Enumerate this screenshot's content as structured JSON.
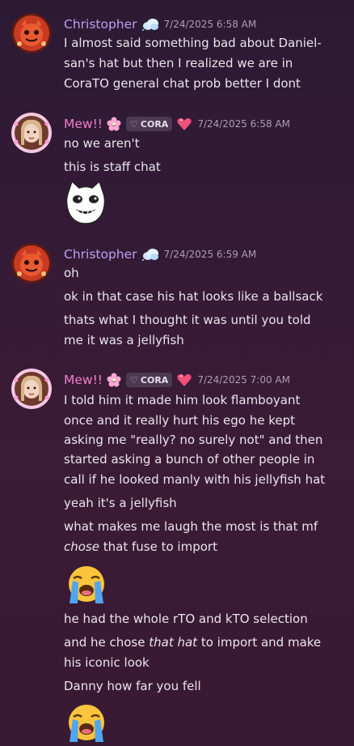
{
  "messages": [
    {
      "author": "Christopher",
      "timestamp": "7/24/2025 6:58 AM",
      "lines": [
        "I almost said something bad about Daniel-",
        "san's hat but then I realized we are in",
        "CoraTO general chat prob better I dont"
      ]
    },
    {
      "author": "Mew!!",
      "tag": "CORA",
      "timestamp": "7/24/2025 6:58 AM",
      "lines": [
        "no we aren't",
        "this is staff chat"
      ],
      "sticker": "cat-face-sticker"
    },
    {
      "author": "Christopher",
      "timestamp": "7/24/2025 6:59 AM",
      "lines": [
        "oh",
        "ok in that case his hat looks like a ballsack",
        "thats what I thought it was until you told",
        "me it was a jellyfish"
      ]
    },
    {
      "author": "Mew!!",
      "tag": "CORA",
      "timestamp": "7/24/2025 7:00 AM",
      "lines": [
        "I told him it made him look flamboyant",
        "once and it really hurt his ego he kept",
        "asking me \"really? no surely not\" and then",
        "started asking a bunch of other people in",
        "call if he looked manly with his jellyfish hat",
        "yeah it's a jellyfish",
        "what makes me laugh the most is that mf",
        "that fuse to import",
        "he had the whole rTO and kTO selection",
        "and he chose",
        "to import and make",
        "his iconic look",
        "Danny how far you fell"
      ],
      "italic": [
        "chose",
        "that hat"
      ]
    }
  ],
  "emojis": [
    "loudly-crying-face",
    "loudly-crying-face"
  ],
  "colors": {
    "christopher_name": "#b9a2ee",
    "mew_name": "#f27fce",
    "timestamp": "#a99eb0",
    "text": "#eae4ec",
    "background": "#341a36"
  }
}
